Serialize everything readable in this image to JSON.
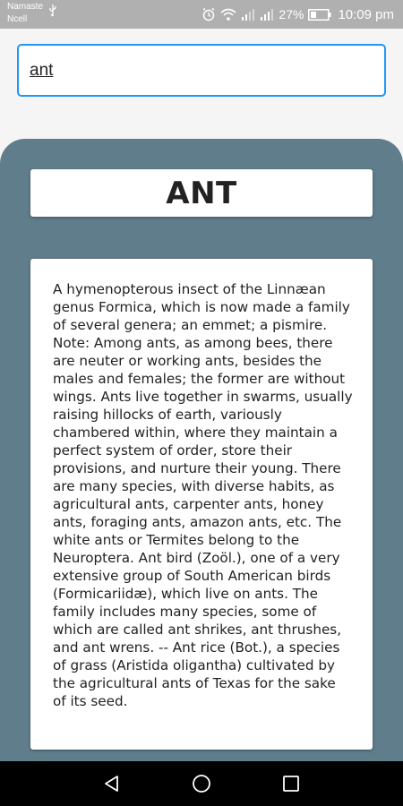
{
  "status_bar": {
    "carrier_line1": "Namaste",
    "carrier_line2": "Ncell",
    "battery_percent": "27%",
    "time": "10:09 pm",
    "icons": [
      "usb-icon",
      "alarm-icon",
      "wifi-icon",
      "signal-icon",
      "signal-icon",
      "battery-icon"
    ]
  },
  "search": {
    "value": "ant"
  },
  "entry": {
    "word": "ANT",
    "definition": "A hymenopterous insect of the Linnæan genus Formica, which is now made a family of several genera; an emmet; a pismire. Note: Among ants, as among bees, there are neuter or working ants, besides the males and females; the former are without wings. Ants live together in swarms, usually raising hillocks of earth, variously chambered within, where they maintain a perfect system of order, store their provisions, and nurture their young. There are many species, with diverse habits, as agricultural ants, carpenter ants, honey ants, foraging ants, amazon ants, etc. The white ants or Termites belong to the Neuroptera. Ant bird (Zoöl.), one of a very extensive group of South American birds (Formicariidæ), which live on ants. The family includes many species, some of which are called ant shrikes, ant thrushes, and ant wrens. -- Ant rice (Bot.), a species of grass (Aristida oligantha) cultivated by the agricultural ants of Texas for the sake of its seed."
  },
  "navigation": {
    "icons": [
      "back-icon",
      "home-icon",
      "recent-apps-icon"
    ]
  },
  "colors": {
    "status_bar": "#b0b0b0",
    "accent": "#2196f3",
    "panel": "#607d8b",
    "nav_bar": "#000000"
  }
}
